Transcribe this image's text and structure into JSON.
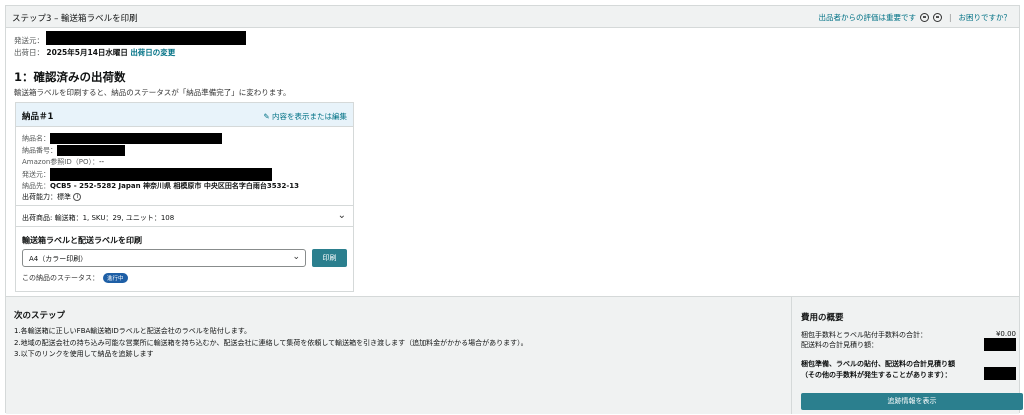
{
  "header": {
    "step_title": "ステップ3 – 輸送箱ラベルを印刷",
    "feedback_link": "出品者からの評価は重要です",
    "help_link": "お困りですか？"
  },
  "meta": {
    "ship_from_label": "発送元：",
    "ship_date_label": "出荷日：",
    "ship_date_value": "2025年5月14日水曜日",
    "change_date_link": "出荷日の変更"
  },
  "section": {
    "title": "1：確認済みの出荷数",
    "description": "輸送箱ラベルを印刷すると、納品のステータスが「納品準備完了」に変わります。"
  },
  "card": {
    "title": "納品＃1",
    "edit_link": "内容を表示または編集",
    "name_label": "納品名：",
    "number_label": "納品番号：",
    "po_label": "Amazon参照ID（PO）：",
    "po_value": "--",
    "from_label": "発送元：",
    "to_label": "納品先：",
    "to_value": "QCB5 - 252-5282 Japan 神奈川県 相模原市 中央区田名字白雨台3532-13",
    "capacity_label": "出荷能力：",
    "capacity_value": "標準",
    "shipment_summary": "出荷商品: 輸送箱：1, SKU：29, ユニット：108",
    "print_title": "輸送箱ラベルと配送ラベルを印刷",
    "select_value": "A4（カラー印刷）",
    "print_button": "印刷",
    "status_label": "この納品のステータス：",
    "status_badge": "進行中"
  },
  "next_steps": {
    "title": "次のステップ",
    "items": [
      "1.各輸送箱に正しいFBA輸送箱IDラベルと配送会社のラベルを貼付します。",
      "2.地域の配送会社の持ち込み可能な営業所に輸送箱を持ち込むか、配送会社に連絡して集荷を依頼して輸送箱を引き渡します（追加料金がかかる場合があります）。",
      "3.以下のリンクを使用して納品を追跡します"
    ]
  },
  "cost_summary": {
    "title": "費用の概要",
    "prep_label": "梱包手数料とラベル貼付手数料の合計：",
    "prep_value": "¥0.00",
    "carrier_label": "配送料の合計見積り額：",
    "total_label_1": "梱包準備、ラベルの貼付、配送料の合計見積り額",
    "total_label_2": "（その他の手数料が発生することがあります）：",
    "track_button": "追跡情報を表示"
  }
}
